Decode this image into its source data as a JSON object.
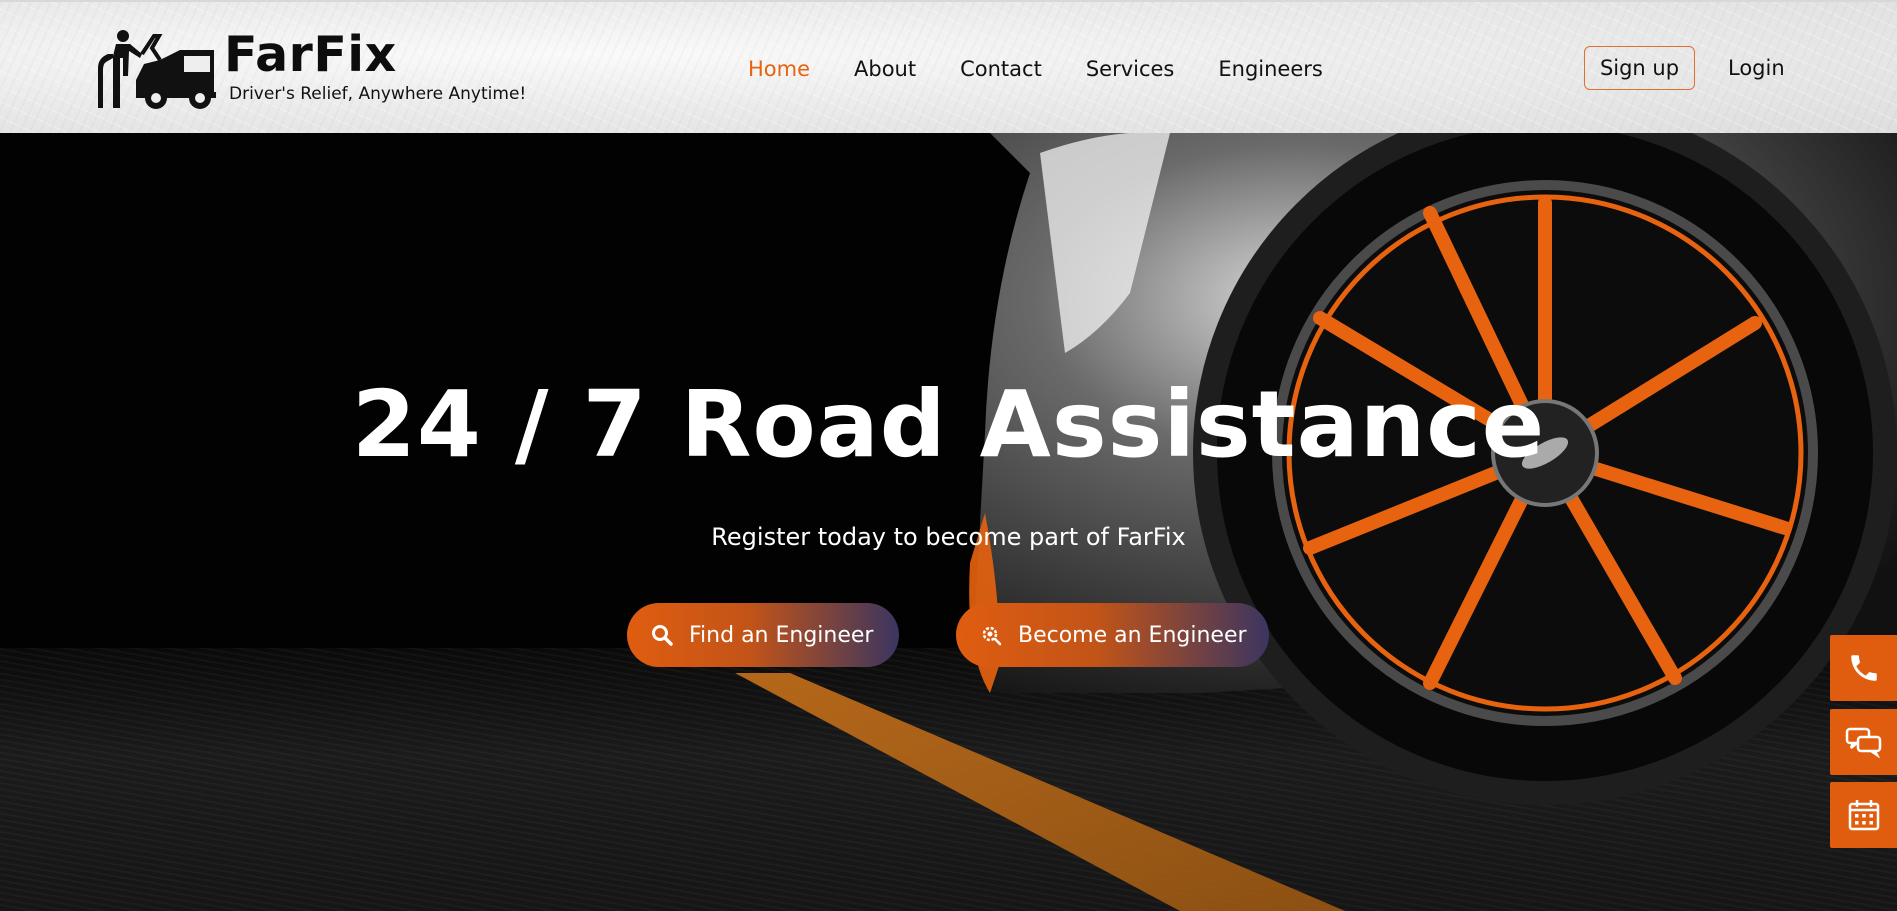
{
  "brand": {
    "name": "FarFix",
    "tagline": "Driver's Relief, Anywhere Anytime!",
    "accent": "#e8630f"
  },
  "nav": {
    "items": [
      {
        "label": "Home",
        "active": true
      },
      {
        "label": "About",
        "active": false
      },
      {
        "label": "Contact",
        "active": false
      },
      {
        "label": "Services",
        "active": false
      },
      {
        "label": "Engineers",
        "active": false
      }
    ]
  },
  "auth": {
    "signup_label": "Sign up",
    "login_label": "Login"
  },
  "hero": {
    "title": "24 / 7 Road Assistance",
    "subtitle": "Register today to become part of FarFix",
    "find_label": "Find an Engineer",
    "become_label": "Become an Engineer"
  },
  "side_widgets": [
    {
      "icon": "phone-icon"
    },
    {
      "icon": "chat-icon"
    },
    {
      "icon": "calendar-icon"
    }
  ]
}
